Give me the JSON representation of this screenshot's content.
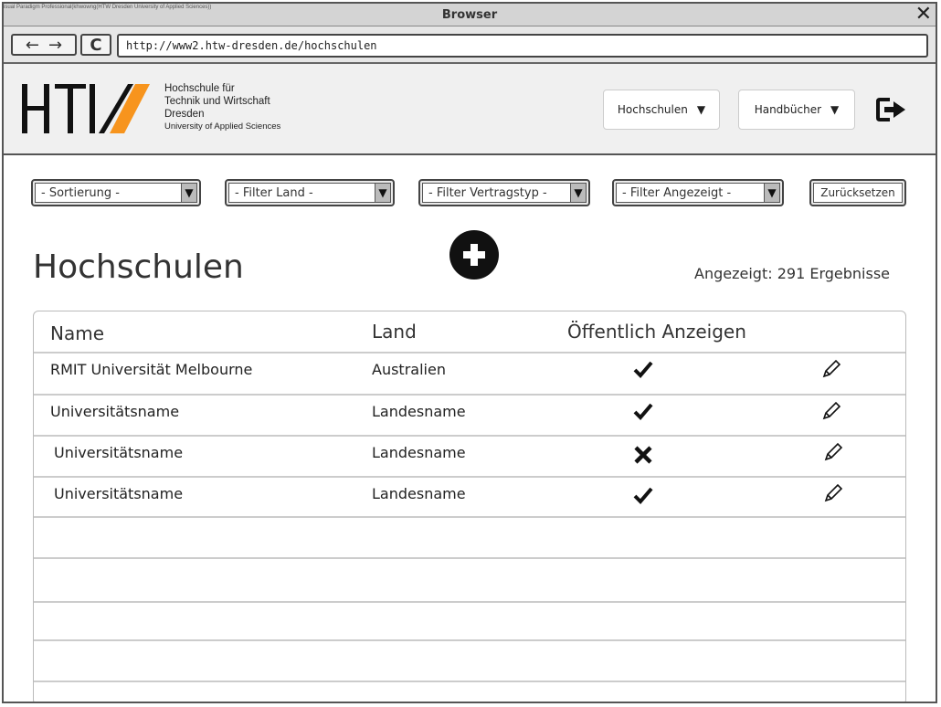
{
  "window": {
    "watermark": "isual Paradigm Professional(khwowng(HTW Dresden University of Applied Sciences))",
    "title": "Browser",
    "close_label": "✕"
  },
  "navbar": {
    "back_label": "←",
    "forward_label": "→",
    "reload_label": "C",
    "url": "http://www2.htw-dresden.de/hochschulen"
  },
  "header": {
    "university_lines": [
      "Hochschule für",
      "Technik und Wirtschaft",
      "Dresden",
      "University of Applied Sciences"
    ],
    "menu": [
      {
        "label": "Hochschulen"
      },
      {
        "label": "Handbücher"
      }
    ]
  },
  "filters": {
    "sort": "- Sortierung -",
    "country": "- Filter Land -",
    "contract": "- Filter Vertragstyp -",
    "displayed": "- Filter Angezeigt -",
    "reset_label": "Zurücksetzen"
  },
  "page": {
    "title": "Hochschulen",
    "result_count": "Angezeigt: 291 Ergebnisse"
  },
  "table": {
    "headers": {
      "name": "Name",
      "country": "Land",
      "public": "Öffentlich Anzeigen"
    },
    "rows": [
      {
        "name": "RMIT Universität Melbourne",
        "country": "Australien",
        "public": true
      },
      {
        "name": "Universitätsname",
        "country": "Landesname",
        "public": true
      },
      {
        "name": "Universitätsname",
        "country": "Landesname",
        "public": false
      },
      {
        "name": "Universitätsname",
        "country": "Landesname",
        "public": true
      }
    ]
  },
  "colors": {
    "logo_accent": "#f7941d",
    "logo_dark": "#111111"
  }
}
